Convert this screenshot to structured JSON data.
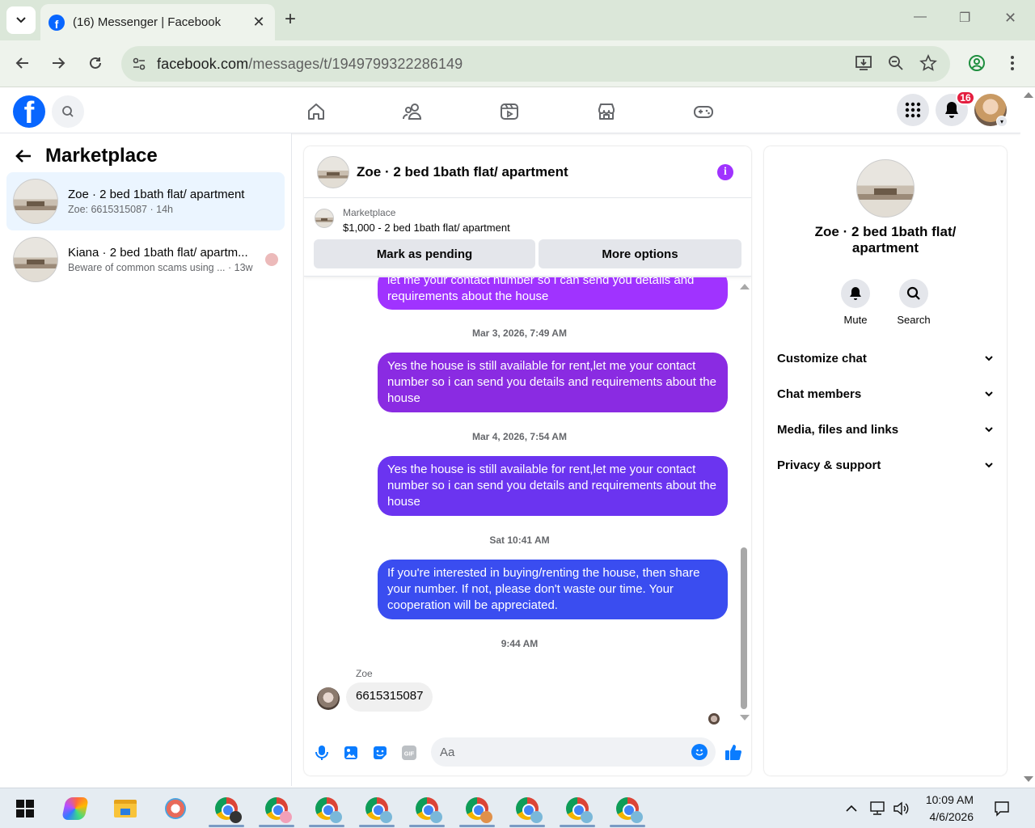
{
  "browser": {
    "tab_title": "(16) Messenger | Facebook",
    "url_host": "facebook.com",
    "url_path": "/messages/t/1949799322286149",
    "icons": [
      "tab-menu-icon",
      "facebook-favicon",
      "close-tab-icon",
      "new-tab-icon",
      "minimize-icon",
      "restore-icon",
      "close-window-icon",
      "back-icon",
      "forward-icon",
      "reload-icon",
      "site-info-icon",
      "install-app-icon",
      "zoom-icon",
      "bookmark-star-icon",
      "profile-icon",
      "more-menu-icon"
    ]
  },
  "fb_header": {
    "notification_count": "16",
    "nav_icons": [
      "home-icon",
      "friends-icon",
      "video-icon",
      "marketplace-icon",
      "gaming-icon"
    ]
  },
  "left_panel": {
    "title": "Marketplace",
    "conversations": [
      {
        "name": "Zoe · 2 bed 1bath flat/ apartment",
        "preview": "Zoe: 6615315087 · 14h",
        "active": true
      },
      {
        "name": "Kiana · 2 bed 1bath flat/ apartm...",
        "preview": "Beware of common scams using ...",
        "time": "· 13w",
        "active": false
      }
    ]
  },
  "chat": {
    "title": "Zoe · 2 bed 1bath flat/ apartment",
    "marketplace_label": "Marketplace",
    "listing": "$1,000 - 2 bed 1bath flat/ apartment",
    "btn_pending": "Mark as pending",
    "btn_more": "More options",
    "messages": [
      {
        "type": "out",
        "text": "let me your contact number so i can send you details and requirements about the house",
        "color": "#a033ff"
      },
      {
        "type": "time",
        "text": "Mar 3, 2026, 7:49 AM"
      },
      {
        "type": "out",
        "text": "Yes the house is still available for rent,let me your contact number so i can send you details and requirements about the house",
        "color": "#8a2be2"
      },
      {
        "type": "time",
        "text": "Mar 4, 2026, 7:54 AM"
      },
      {
        "type": "out",
        "text": "Yes the house is still available for rent,let me your contact number so i can send you details and requirements about the house",
        "color": "#6b34f0"
      },
      {
        "type": "time",
        "text": "Sat 10:41 AM"
      },
      {
        "type": "out",
        "text": "If you're interested in buying/renting the house, then share your number. If not, please don't waste our time. Your cooperation will be appreciated.",
        "color": "#3a4df0"
      },
      {
        "type": "time",
        "text": "9:44 AM"
      }
    ],
    "incoming_sender": "Zoe",
    "incoming_text": "6615315087",
    "composer_placeholder": "Aa",
    "composer_icons": [
      "microphone-icon",
      "gallery-icon",
      "sticker-icon",
      "gif-icon",
      "emoji-icon",
      "thumbs-up-icon"
    ]
  },
  "right_panel": {
    "name": "Zoe · 2 bed 1bath flat/ apartment",
    "mute_label": "Mute",
    "search_label": "Search",
    "sections": [
      "Customize chat",
      "Chat members",
      "Media, files and links",
      "Privacy & support"
    ]
  },
  "taskbar": {
    "time": "10:09 AM",
    "date": "4/6/2026"
  },
  "colors": {
    "fb_blue": "#0866ff",
    "messenger_purple": "#a033ff",
    "messenger_blue": "#3a4df0",
    "badge_red": "#e41e3f"
  }
}
